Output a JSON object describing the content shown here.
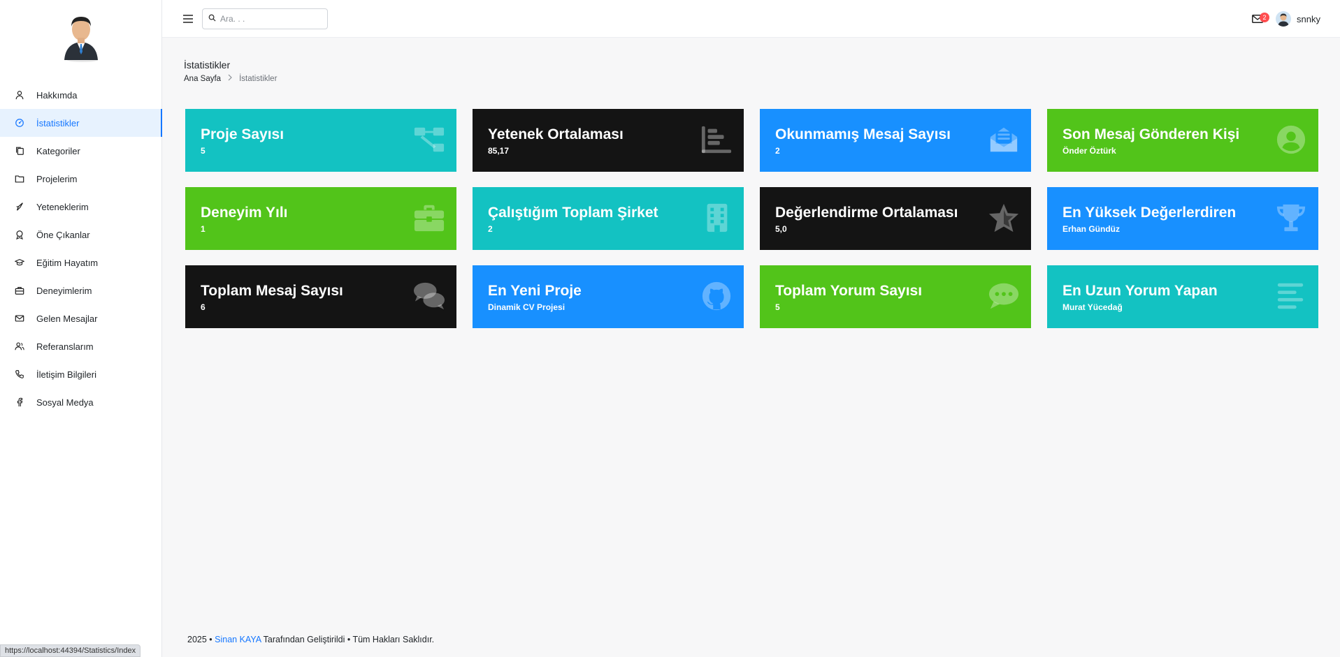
{
  "sidebar": {
    "items": [
      {
        "label": "Hakkımda",
        "icon": "user-icon"
      },
      {
        "label": "İstatistikler",
        "icon": "dashboard-icon",
        "active": true
      },
      {
        "label": "Kategoriler",
        "icon": "copy-icon"
      },
      {
        "label": "Projelerim",
        "icon": "folder-icon"
      },
      {
        "label": "Yeteneklerim",
        "icon": "rocket-icon"
      },
      {
        "label": "Öne Çıkanlar",
        "icon": "badge-icon"
      },
      {
        "label": "Eğitim Hayatım",
        "icon": "graduation-icon"
      },
      {
        "label": "Deneyimlerim",
        "icon": "briefcase-icon"
      },
      {
        "label": "Gelen Mesajlar",
        "icon": "mail-icon"
      },
      {
        "label": "Referanslarım",
        "icon": "team-icon"
      },
      {
        "label": "İletişim Bilgileri",
        "icon": "phone-icon"
      },
      {
        "label": "Sosyal Medya",
        "icon": "facebook-icon"
      }
    ]
  },
  "header": {
    "search_placeholder": "Ara. . .",
    "mail_count": "2",
    "username": "snnky"
  },
  "page": {
    "title": "İstatistikler",
    "breadcrumb_home": "Ana Sayfa",
    "breadcrumb_current": "İstatistikler"
  },
  "cards": [
    {
      "title": "Proje Sayısı",
      "value": "5",
      "color": "#13c2c2",
      "icon": "project-tree-icon"
    },
    {
      "title": "Yetenek Ortalaması",
      "value": "85,17",
      "color": "#141414",
      "icon": "bar-chart-icon"
    },
    {
      "title": "Okunmamış Mesaj Sayısı",
      "value": "2",
      "color": "#1890ff",
      "icon": "envelope-open-icon"
    },
    {
      "title": "Son Mesaj Gönderen Kişi",
      "value": "Önder Öztürk",
      "color": "#52c41a",
      "icon": "user-circle-icon"
    },
    {
      "title": "Deneyim Yılı",
      "value": "1",
      "color": "#52c41a",
      "icon": "briefcase-icon"
    },
    {
      "title": "Çalıştığım Toplam Şirket",
      "value": "2",
      "color": "#13c2c2",
      "icon": "building-icon"
    },
    {
      "title": "Değerlendirme Ortalaması",
      "value": "5,0",
      "color": "#141414",
      "icon": "star-icon"
    },
    {
      "title": "En Yüksek Değerlerdiren",
      "value": "Erhan Gündüz",
      "color": "#1890ff",
      "icon": "trophy-icon"
    },
    {
      "title": "Toplam Mesaj Sayısı",
      "value": "6",
      "color": "#141414",
      "icon": "comments-icon"
    },
    {
      "title": "En Yeni Proje",
      "value": "Dinamik CV Projesi",
      "color": "#1890ff",
      "icon": "github-icon"
    },
    {
      "title": "Toplam Yorum Sayısı",
      "value": "5",
      "color": "#52c41a",
      "icon": "comment-dots-icon"
    },
    {
      "title": "En Uzun Yorum Yapan",
      "value": "Murat Yücedağ",
      "color": "#13c2c2",
      "icon": "align-left-icon"
    }
  ],
  "footer": {
    "prefix": "2025 • ",
    "author": "Sinan KAYA",
    "suffix": " Tarafından Geliştirildi • Tüm Hakları Saklıdır."
  },
  "status_url": "https://localhost:44394/Statistics/Index"
}
